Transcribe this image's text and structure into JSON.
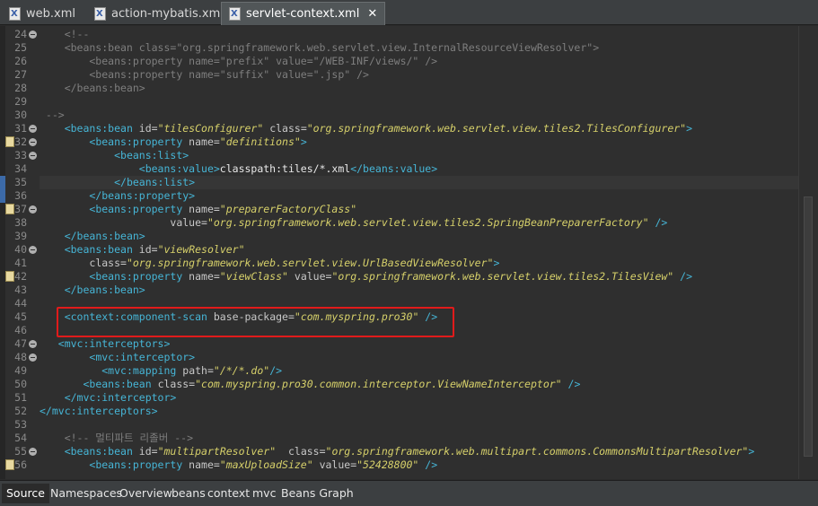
{
  "tabs": [
    {
      "label": "web.xml",
      "active": false
    },
    {
      "label": "action-mybatis.xml",
      "active": false
    },
    {
      "label": "servlet-context.xml",
      "active": true
    }
  ],
  "close_glyph": "✕",
  "current_line": 35,
  "lines": [
    {
      "n": "24",
      "fold": true,
      "tokens": [
        [
          "cm",
          "    <!--"
        ]
      ]
    },
    {
      "n": "25",
      "tokens": [
        [
          "cm",
          "    <beans:bean class=\"org.springframework.web.servlet.view.InternalResourceViewResolver\">"
        ]
      ]
    },
    {
      "n": "26",
      "tokens": [
        [
          "cm",
          "        <beans:property name=\"prefix\" value=\"/WEB-INF/views/\" />"
        ]
      ]
    },
    {
      "n": "27",
      "tokens": [
        [
          "cm",
          "        <beans:property name=\"suffix\" value=\".jsp\" />"
        ]
      ]
    },
    {
      "n": "28",
      "tokens": [
        [
          "cm",
          "    </beans:bean>"
        ]
      ]
    },
    {
      "n": "29",
      "tokens": [
        [
          "tx",
          ""
        ]
      ]
    },
    {
      "n": "30",
      "tokens": [
        [
          "cm",
          " -->"
        ]
      ]
    },
    {
      "n": "31",
      "fold": true,
      "tokens": [
        [
          "tx",
          "    "
        ],
        [
          "tg",
          "<beans:bean"
        ],
        [
          "at",
          " id="
        ],
        [
          "st",
          "\"tilesConfigurer\""
        ],
        [
          "at",
          " class="
        ],
        [
          "st",
          "\"org.springframework.web.servlet.view.tiles2.TilesConfigurer\""
        ],
        [
          "tg",
          ">"
        ]
      ]
    },
    {
      "n": "32",
      "fold": true,
      "marker": true,
      "tokens": [
        [
          "tx",
          "        "
        ],
        [
          "tg",
          "<beans:property"
        ],
        [
          "at",
          " name="
        ],
        [
          "st",
          "\"definitions\""
        ],
        [
          "tg",
          ">"
        ]
      ]
    },
    {
      "n": "33",
      "fold": true,
      "tokens": [
        [
          "tx",
          "            "
        ],
        [
          "tg",
          "<beans:list>"
        ]
      ]
    },
    {
      "n": "34",
      "tokens": [
        [
          "tx",
          "                "
        ],
        [
          "tg",
          "<beans:value>"
        ],
        [
          "tx",
          "classpath:tiles/*.xml"
        ],
        [
          "tg",
          "</beans:value>"
        ]
      ]
    },
    {
      "n": "35",
      "blue": true,
      "tokens": [
        [
          "tx",
          "            "
        ],
        [
          "tg",
          "</beans:list>"
        ]
      ]
    },
    {
      "n": "36",
      "blue": true,
      "tokens": [
        [
          "tx",
          "        "
        ],
        [
          "tg",
          "</beans:property>"
        ]
      ]
    },
    {
      "n": "37",
      "fold": true,
      "marker": true,
      "tokens": [
        [
          "tx",
          "        "
        ],
        [
          "tg",
          "<beans:property"
        ],
        [
          "at",
          " name="
        ],
        [
          "st",
          "\"preparerFactoryClass\""
        ]
      ]
    },
    {
      "n": "38",
      "tokens": [
        [
          "tx",
          "                     "
        ],
        [
          "at",
          "value="
        ],
        [
          "st",
          "\"org.springframework.web.servlet.view.tiles2.SpringBeanPreparerFactory\""
        ],
        [
          "tg",
          " />"
        ]
      ]
    },
    {
      "n": "39",
      "tokens": [
        [
          "tx",
          "    "
        ],
        [
          "tg",
          "</beans:bean>"
        ]
      ]
    },
    {
      "n": "40",
      "fold": true,
      "tokens": [
        [
          "tx",
          "    "
        ],
        [
          "tg",
          "<beans:bean"
        ],
        [
          "at",
          " id="
        ],
        [
          "st",
          "\"viewResolver\""
        ]
      ]
    },
    {
      "n": "41",
      "tokens": [
        [
          "tx",
          "        "
        ],
        [
          "at",
          "class="
        ],
        [
          "st",
          "\"org.springframework.web.servlet.view.UrlBasedViewResolver\""
        ],
        [
          "tg",
          ">"
        ]
      ]
    },
    {
      "n": "42",
      "marker": true,
      "tokens": [
        [
          "tx",
          "        "
        ],
        [
          "tg",
          "<beans:property"
        ],
        [
          "at",
          " name="
        ],
        [
          "st",
          "\"viewClass\""
        ],
        [
          "at",
          " value="
        ],
        [
          "st",
          "\"org.springframework.web.servlet.view.tiles2.TilesView\""
        ],
        [
          "tg",
          " />"
        ]
      ]
    },
    {
      "n": "43",
      "tokens": [
        [
          "tx",
          "    "
        ],
        [
          "tg",
          "</beans:bean>"
        ]
      ]
    },
    {
      "n": "44",
      "tokens": [
        [
          "tx",
          ""
        ]
      ]
    },
    {
      "n": "45",
      "tokens": [
        [
          "tx",
          "    "
        ],
        [
          "tg",
          "<context:component-scan"
        ],
        [
          "at",
          " base-package="
        ],
        [
          "st",
          "\"com.myspring.pro30\""
        ],
        [
          "tg",
          " />"
        ]
      ]
    },
    {
      "n": "46",
      "tokens": [
        [
          "tx",
          ""
        ]
      ]
    },
    {
      "n": "47",
      "fold": true,
      "tokens": [
        [
          "tx",
          "   "
        ],
        [
          "tg",
          "<mvc:interceptors>"
        ]
      ]
    },
    {
      "n": "48",
      "fold": true,
      "tokens": [
        [
          "tx",
          "        "
        ],
        [
          "tg",
          "<mvc:interceptor>"
        ]
      ]
    },
    {
      "n": "49",
      "tokens": [
        [
          "tx",
          "          "
        ],
        [
          "tg",
          "<mvc:mapping"
        ],
        [
          "at",
          " path="
        ],
        [
          "st",
          "\"/*/*.do\""
        ],
        [
          "tg",
          "/>"
        ]
      ]
    },
    {
      "n": "50",
      "tokens": [
        [
          "tx",
          "       "
        ],
        [
          "tg",
          "<beans:bean"
        ],
        [
          "at",
          " class="
        ],
        [
          "st",
          "\"com.myspring.pro30.common.interceptor.ViewNameInterceptor\""
        ],
        [
          "tg",
          " />"
        ]
      ]
    },
    {
      "n": "51",
      "tokens": [
        [
          "tx",
          "    "
        ],
        [
          "tg",
          "</mvc:interceptor>"
        ]
      ]
    },
    {
      "n": "52",
      "tokens": [
        [
          "tg",
          "</mvc:interceptors>"
        ]
      ]
    },
    {
      "n": "53",
      "tokens": [
        [
          "tx",
          ""
        ]
      ]
    },
    {
      "n": "54",
      "tokens": [
        [
          "cm",
          "    <!-- 멀티파트 리졸버 -->"
        ]
      ]
    },
    {
      "n": "55",
      "fold": true,
      "tokens": [
        [
          "tx",
          "    "
        ],
        [
          "tg",
          "<beans:bean"
        ],
        [
          "at",
          " id="
        ],
        [
          "st",
          "\"multipartResolver\""
        ],
        [
          "at",
          "  class="
        ],
        [
          "st",
          "\"org.springframework.web.multipart.commons.CommonsMultipartResolver\""
        ],
        [
          "tg",
          ">"
        ]
      ]
    },
    {
      "n": "56",
      "marker": true,
      "tokens": [
        [
          "tx",
          "        "
        ],
        [
          "tg",
          "<beans:property"
        ],
        [
          "at",
          " name="
        ],
        [
          "st",
          "\"maxUploadSize\""
        ],
        [
          "at",
          " value="
        ],
        [
          "st",
          "\"52428800\""
        ],
        [
          "tg",
          " />"
        ]
      ]
    }
  ],
  "bottom_tabs": [
    {
      "label": "Source",
      "active": true
    },
    {
      "label": "Namespaces",
      "active": false
    },
    {
      "label": "Overview",
      "active": false
    },
    {
      "label": "beans",
      "active": false
    },
    {
      "label": "context",
      "active": false
    },
    {
      "label": "mvc",
      "active": false
    },
    {
      "label": "Beans Graph",
      "active": false
    }
  ],
  "colors": {
    "tag": "#46b5d6",
    "string": "#d6d06a",
    "comment": "#7e7e7e",
    "highlight_box": "#e11b1b"
  }
}
